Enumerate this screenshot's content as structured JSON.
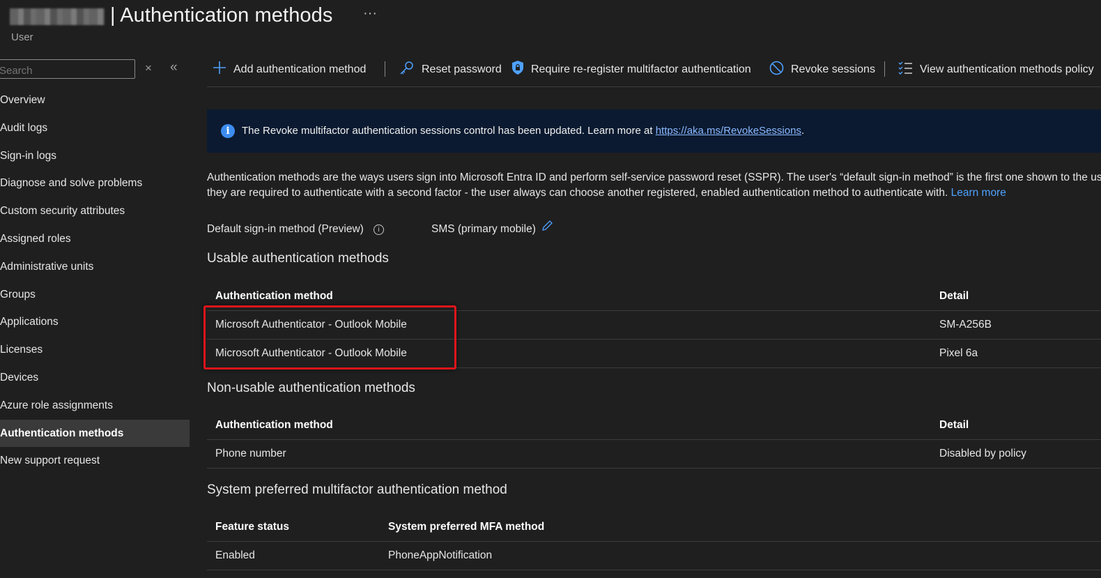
{
  "header": {
    "title": "| Authentication methods",
    "ellipsis": "···",
    "subtitle": "User"
  },
  "sidebar": {
    "search_placeholder": "Search",
    "close": "×",
    "collapse": "«",
    "items": [
      {
        "label": "Overview"
      },
      {
        "label": "Audit logs"
      },
      {
        "label": "Sign-in logs"
      },
      {
        "label": "Diagnose and solve problems"
      },
      {
        "label": "Custom security attributes"
      },
      {
        "label": "Assigned roles"
      },
      {
        "label": "Administrative units"
      },
      {
        "label": "Groups"
      },
      {
        "label": "Applications"
      },
      {
        "label": "Licenses"
      },
      {
        "label": "Devices"
      },
      {
        "label": "Azure role assignments"
      },
      {
        "label": "Authentication methods",
        "active": true
      },
      {
        "label": "New support request"
      }
    ]
  },
  "toolbar": {
    "add_label": "Add authentication method",
    "reset_label": "Reset password",
    "reregister_label": "Require re-register multifactor authentication",
    "revoke_label": "Revoke sessions",
    "view_label": "View authentication methods policy"
  },
  "banner": {
    "text": "The Revoke multifactor authentication sessions control has been updated. Learn more at ",
    "link": "https://aka.ms/RevokeSessions",
    "suffix": "."
  },
  "description": {
    "line1": "Authentication methods are the ways users sign into Microsoft Entra ID and perform self-service password reset (SSPR). The user's “default sign-in method” is the first one shown to the user. If",
    "line2": "they are required to authenticate with a second factor - the user always can choose another registered, enabled authentication method to authenticate with. ",
    "learn_more": "Learn more"
  },
  "default_sign_in": {
    "label": "Default sign-in method (Preview)",
    "value": "SMS (primary mobile)"
  },
  "usable": {
    "title": "Usable authentication methods",
    "col1": "Authentication method",
    "col2": "Detail",
    "rows": [
      {
        "method": "Microsoft Authenticator - Outlook Mobile",
        "detail": "SM-A256B"
      },
      {
        "method": "Microsoft Authenticator - Outlook Mobile",
        "detail": "Pixel 6a"
      }
    ]
  },
  "non_usable": {
    "title": "Non-usable authentication methods",
    "col1": "Authentication method",
    "col2": "Detail",
    "rows": [
      {
        "method": "Phone number",
        "detail": "Disabled by policy"
      }
    ]
  },
  "system_preferred": {
    "title": "System preferred multifactor authentication method",
    "col1": "Feature status",
    "col2": "System preferred MFA method",
    "rows": [
      {
        "status": "Enabled",
        "method": "PhoneAppNotification"
      }
    ]
  },
  "colors": {
    "background": "#1f1f1f",
    "accent": "#4ea1ff",
    "banner": "#0b1a30",
    "highlight": "#e0151a"
  }
}
